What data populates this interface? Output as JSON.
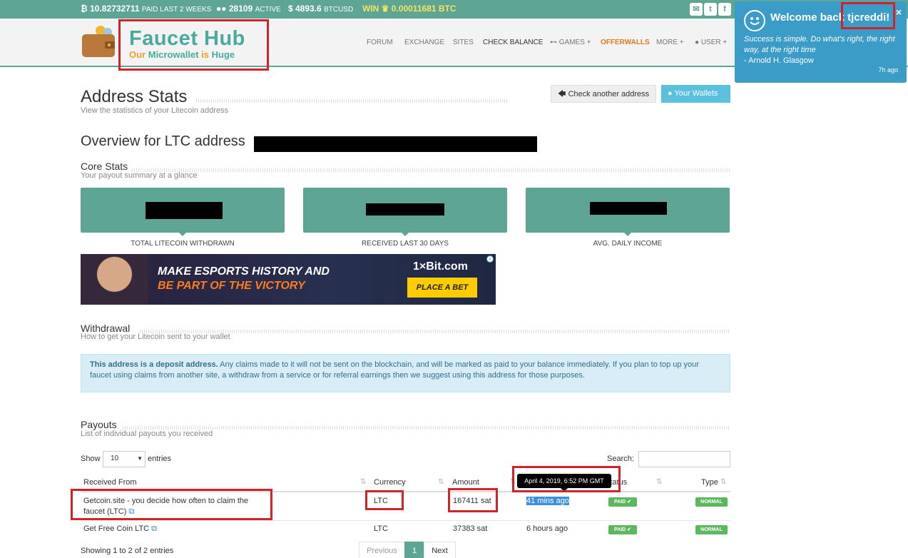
{
  "topbar": {
    "btc_paid": "10.82732711",
    "btc_paid_label": "PAID LAST 2 WEEKS",
    "active_count": "28109",
    "active_label": "ACTIVE",
    "btcusd": "$ 4893.6",
    "btcusd_label": "BTCUSD",
    "win_label": "WIN",
    "win_value": "0.00011681 BTC",
    "social": [
      "envelope-icon",
      "twitter-icon",
      "facebook-icon"
    ],
    "accent_color": "#5fa596"
  },
  "logo": {
    "title": "Faucet Hub",
    "subtitle_pre": "Our ",
    "subtitle_mid": "Microwallet",
    "subtitle_mid2": " is ",
    "subtitle_end": "Huge"
  },
  "nav": {
    "forum": "FORUM",
    "exchange": "EXCHANGE",
    "sites": "SITES",
    "check_balance": "CHECK BALANCE",
    "games": "GAMES +",
    "offerwalls": "OFFERWALLS",
    "more": "MORE +",
    "user": "USER +"
  },
  "page": {
    "title": "Address Stats",
    "subtitle": "View the statistics of your Litecoin address",
    "btn_check": "Check another address",
    "btn_wallets": "Your Wallets",
    "overview": "Overview for LTC address"
  },
  "core": {
    "title": "Core Stats",
    "subtitle": "Your payout summary at a glance",
    "labels": [
      "TOTAL LITECOIN WITHDRAWN",
      "RECEIVED LAST 30 DAYS",
      "AVG. DAILY INCOME"
    ]
  },
  "ad": {
    "line1": "MAKE ESPORTS HISTORY AND",
    "line2": "BE PART OF THE VICTORY",
    "brand": "1×Bit.com",
    "cta": "PLACE A BET"
  },
  "withdrawal": {
    "title": "Withdrawal",
    "subtitle": "How to get your Litecoin sent to your wallet",
    "alert_bold": "This address is a deposit address.",
    "alert_text": " Any claims made to it will not be sent on the blockchain, and will be marked as paid to your balance immediately. If you plan to top up your faucet using claims from another site, a withdraw from a service or for referral earnings then we suggest using this address for those purposes."
  },
  "payouts": {
    "title": "Payouts",
    "subtitle": "List of individual payouts you received",
    "show_label": "Show",
    "entries_value": "10",
    "entries_label": "entries",
    "search_label": "Search:",
    "columns": [
      "Received From",
      "Currency",
      "Amount",
      "Status",
      "Type"
    ],
    "tooltip": "April 4, 2019, 6:52 PM GMT",
    "rows": [
      {
        "from": "Getcoin.site - you decide how often to claim the",
        "from2": "faucet (LTC)",
        "currency": "LTC",
        "amount": "167411 sat",
        "time": "41 mins ago",
        "status": "PAID ✔",
        "type": "NORMAL"
      },
      {
        "from": "Get Free Coin LTC",
        "currency": "LTC",
        "amount": "37383 sat",
        "time": "6 hours ago",
        "status": "PAID ✔",
        "type": "NORMAL"
      }
    ],
    "showing": "Showing 1 to 2 of 2 entries",
    "pager": [
      "Previous",
      "1",
      "Next"
    ]
  },
  "notification": {
    "title_pre": "Welcome back",
    "username": "tjcreddi!",
    "quote": "Success is simple. Do what's right, the right way, at the right time",
    "author": "- Arnold H. Glasgow",
    "ago": "7h ago",
    "close": "×"
  }
}
